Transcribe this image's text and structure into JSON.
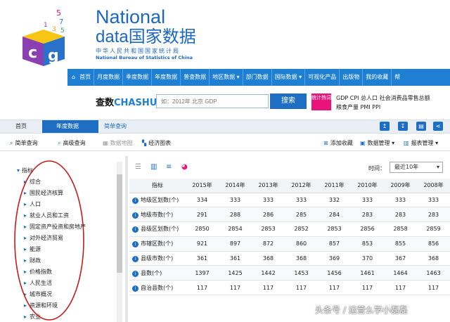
{
  "header": {
    "logo_national": "National",
    "logo_data": "data国家数据",
    "logo_cn": "中华人民共和国国家统计局",
    "logo_en": "National Bureau of Statistics of China",
    "logo_digits": "57135"
  },
  "nav": {
    "items": [
      "首页",
      "月度数据",
      "季度数据",
      "年度数据",
      "普查数据",
      "地区数据 ▾",
      "部门数据",
      "国际数据 ▾",
      "可视化产品",
      "出版物",
      "我的收藏",
      "帮"
    ]
  },
  "search": {
    "brand_cn": "查数",
    "brand_en": "CHASHU",
    "placeholder": "如：2012年 北京 GDP",
    "button": "搜索",
    "hot_badge": "统计热词",
    "hot_links_row1": "GDP CPI 总人口 社会消费品零售总额",
    "hot_links_row2": "粮食产量 PMI PPI"
  },
  "breadcrumb": {
    "home": "首页",
    "active": "年度数据",
    "next": "简单查询"
  },
  "toolbar": {
    "simple_query": "简单查询",
    "advanced_query": "高级查询",
    "data_map": "数据地图",
    "econ_chart": "经济图表",
    "add_favorite": "添加收藏",
    "data_manage": "数据管理",
    "report_manage": "报表管理"
  },
  "tree": {
    "root": "指标",
    "items": [
      "综合",
      "国民经济核算",
      "人口",
      "就业人员和工资",
      "固定资产投资和房地产",
      "对外经济贸易",
      "能源",
      "财政",
      "价格指数",
      "人民生活",
      "城市概况",
      "资源和环境",
      "农业"
    ]
  },
  "table": {
    "time_label": "时间：",
    "time_value": "最近10年",
    "corner": "指标",
    "columns": [
      "2015年",
      "2014年",
      "2013年",
      "2012年",
      "2011年",
      "2010年",
      "2009年",
      "2008年"
    ],
    "rows": [
      {
        "name": "地级区划数(个)",
        "values": [
          "334",
          "333",
          "333",
          "333",
          "332",
          "333",
          "333",
          "333"
        ]
      },
      {
        "name": "地级市数(个)",
        "values": [
          "291",
          "288",
          "286",
          "285",
          "284",
          "283",
          "283",
          "283"
        ]
      },
      {
        "name": "县级区划数(个)",
        "values": [
          "2850",
          "2854",
          "2853",
          "2852",
          "2853",
          "2856",
          "2858",
          "2859"
        ]
      },
      {
        "name": "市辖区数(个)",
        "values": [
          "921",
          "897",
          "872",
          "860",
          "857",
          "853",
          "855",
          "856"
        ]
      },
      {
        "name": "县级市数(个)",
        "values": [
          "361",
          "361",
          "368",
          "368",
          "369",
          "370",
          "367",
          "368"
        ]
      },
      {
        "name": "县数(个)",
        "values": [
          "1397",
          "1425",
          "1442",
          "1453",
          "1456",
          "1461",
          "1464",
          "1463"
        ]
      },
      {
        "name": "自治县数(个)",
        "values": [
          "117",
          "117",
          "117",
          "117",
          "117",
          "117",
          "117",
          "117"
        ]
      }
    ]
  },
  "watermark": "头条号 / 运营么学小磊磊",
  "colors": {
    "brand_blue": "#1e7fd3",
    "accent_pink": "#e8147a",
    "annotation_red": "#c81a1a"
  }
}
